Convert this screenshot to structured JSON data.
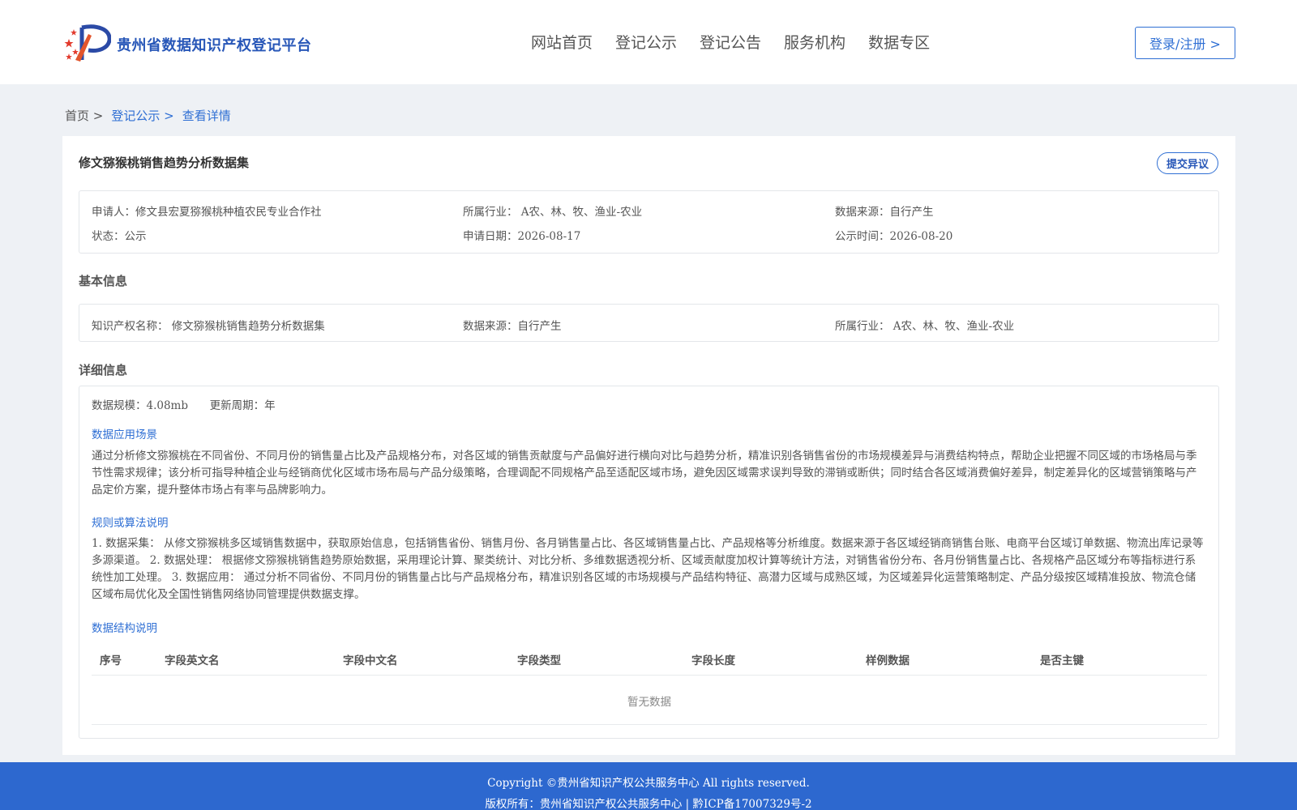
{
  "header": {
    "brand": "贵州省数据知识产权登记平台",
    "nav": [
      "网站首页",
      "登记公示",
      "登记公告",
      "服务机构",
      "数据专区"
    ],
    "login_label": "登录/注册 >"
  },
  "breadcrumb": {
    "home": "首页 >",
    "section": "登记公示 >",
    "current": "查看详情"
  },
  "record": {
    "title": "修文猕猴桃销售趋势分析数据集",
    "objection_label": "提交异议",
    "summary": {
      "applicant": "申请人：修文县宏夏猕猴桃种植农民专业合作社",
      "industry": "所属行业： A农、林、牧、渔业-农业",
      "source": "数据来源：自行产生",
      "status": "状态：公示",
      "apply_date": "申请日期：2026-08-17",
      "publish_date": "公示时间：2026-08-20"
    }
  },
  "basic": {
    "heading": "基本信息",
    "ip_name": "知识产权名称： 修文猕猴桃销售趋势分析数据集",
    "source": "数据来源：自行产生",
    "industry": "所属行业： A农、林、牧、渔业-农业"
  },
  "detail": {
    "heading": "详细信息",
    "scale": "数据规模：4.08mb",
    "cycle": "更新周期：年",
    "scenario_title": "数据应用场景",
    "scenario_text": "通过分析修文猕猴桃在不同省份、不同月份的销售量占比及产品规格分布，对各区域的销售贡献度与产品偏好进行横向对比与趋势分析，精准识别各销售省份的市场规模差异与消费结构特点，帮助企业把握不同区域的市场格局与季节性需求规律；该分析可指导种植企业与经销商优化区域市场布局与产品分级策略，合理调配不同规格产品至适配区域市场，避免因区域需求误判导致的滞销或断供；同时结合各区域消费偏好差异，制定差异化的区域营销策略与产品定价方案，提升整体市场占有率与品牌影响力。",
    "rules_title": "规则或算法说明",
    "rules_text": "1. 数据采集： 从修文猕猴桃多区域销售数据中，获取原始信息，包括销售省份、销售月份、各月销售量占比、各区域销售量占比、产品规格等分析维度。数据来源于各区域经销商销售台账、电商平台区域订单数据、物流出库记录等多源渠道。 2. 数据处理： 根据修文猕猴桃销售趋势原始数据，采用理论计算、聚类统计、对比分析、多维数据透视分析、区域贡献度加权计算等统计方法，对销售省份分布、各月份销售量占比、各规格产品区域分布等指标进行系统性加工处理。 3. 数据应用： 通过分析不同省份、不同月份的销售量占比与产品规格分布，精准识别各区域的市场规模与产品结构特征、高潜力区域与成熟区域，为区域差异化运营策略制定、产品分级按区域精准投放、物流仓储区域布局优化及全国性销售网络协同管理提供数据支撑。",
    "structure_title": "数据结构说明",
    "table_headers": [
      "序号",
      "字段英文名",
      "字段中文名",
      "字段类型",
      "字段长度",
      "样例数据",
      "是否主键"
    ],
    "empty_text": "暂无数据"
  },
  "footer": {
    "line1": "Copyright ©贵州省知识产权公共服务中心 All rights reserved.",
    "line2": "版权所有：贵州省知识产权公共服务中心 | 黔ICP备17007329号-2"
  },
  "colors": {
    "accent": "#2f6fd4",
    "brand": "#2857b8",
    "footer_bg": "#2d68cf",
    "page_bg": "#eef1f5"
  }
}
